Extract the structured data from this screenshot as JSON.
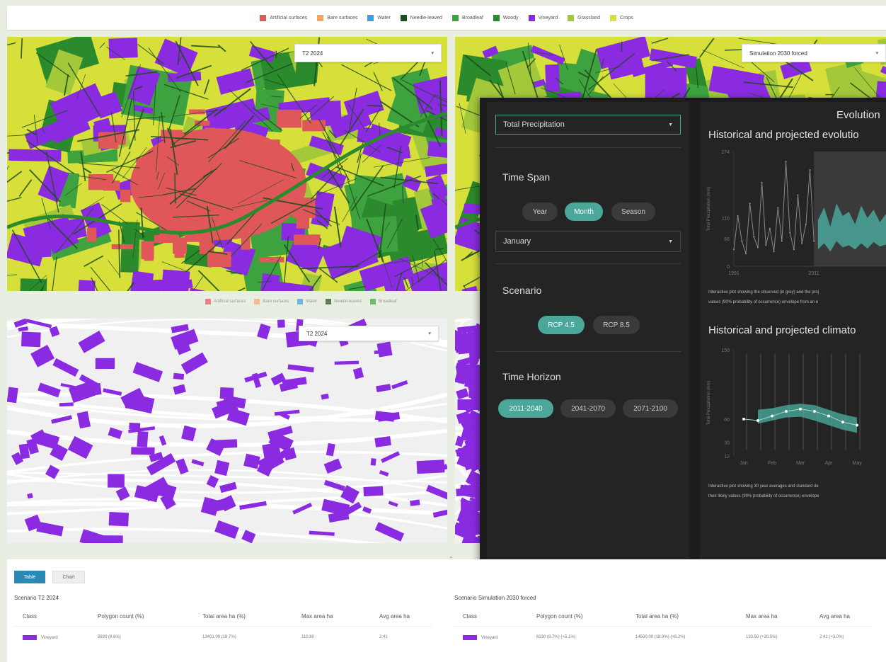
{
  "legend": {
    "items": [
      {
        "label": "Artificial surfaces",
        "color": "#e0575a"
      },
      {
        "label": "Bare surfaces",
        "color": "#f2a766"
      },
      {
        "label": "Water",
        "color": "#3aa0e0"
      },
      {
        "label": "Needle-leaved",
        "color": "#1d4d1d"
      },
      {
        "label": "Broadleaf",
        "color": "#3ea33e"
      },
      {
        "label": "Woody",
        "color": "#2b8a2b"
      },
      {
        "label": "Vineyard",
        "color": "#8a2be2"
      },
      {
        "label": "Grassland",
        "color": "#a3c83a"
      },
      {
        "label": "Crops",
        "color": "#d7e03a"
      }
    ]
  },
  "maps": {
    "top_left_select": "T2 2024",
    "top_right_select": "Simulation 2030 forced",
    "bottom_left_select": "T2 2024"
  },
  "panel": {
    "variable_select": "Total Precipitation",
    "time_span_title": "Time Span",
    "time_span_options": [
      "Year",
      "Month",
      "Season"
    ],
    "time_span_selected": "Month",
    "month_select": "January",
    "scenario_title": "Scenario",
    "scenario_options": [
      "RCP 4.5",
      "RCP 8.5"
    ],
    "scenario_selected": "RCP 4.5",
    "horizon_title": "Time Horizon",
    "horizon_options": [
      "2011-2040",
      "2041-2070",
      "2071-2100"
    ],
    "horizon_selected": "2011-2040",
    "main_title": "Evolution",
    "chart1_title": "Historical and projected evolutio",
    "chart1_desc_1": "Interactive plot showing the observed (in grey) and the proj",
    "chart1_desc_2": "values (90% probability of occurrence) envelope from an e",
    "chart2_title": "Historical and projected climato",
    "chart2_desc_1": "Interactive plot showing 30 year averages and standard de",
    "chart2_desc_2": "their likely values (90% probability of occurrence) envelope"
  },
  "chart_data": [
    {
      "type": "line",
      "title": "Historical and projected evolutio",
      "ylabel": "Total Precipitation (mm)",
      "y_ticks": [
        "274",
        "116",
        "66",
        "0"
      ],
      "x_ticks": [
        "1991",
        "2011"
      ],
      "ylim": [
        0,
        274
      ],
      "x": [
        1991,
        1992,
        1993,
        1994,
        1995,
        1996,
        1997,
        1998,
        1999,
        2000,
        2001,
        2002,
        2003,
        2004,
        2005,
        2006,
        2007,
        2008,
        2009,
        2010,
        2011,
        2012,
        2013,
        2014,
        2015,
        2016,
        2017,
        2018,
        2019,
        2020,
        2021,
        2022,
        2023
      ],
      "series": [
        {
          "values": [
            40,
            120,
            60,
            30,
            150,
            70,
            45,
            200,
            50,
            90,
            35,
            140,
            60,
            250,
            80,
            40,
            170,
            55,
            100,
            230,
            60,
            110,
            85,
            70,
            120,
            65,
            95,
            80,
            130,
            75,
            105,
            90,
            115
          ]
        }
      ],
      "band_low": [
        40,
        55,
        35,
        60,
        45,
        50,
        40,
        55,
        42,
        58,
        47,
        52
      ],
      "band_high": [
        110,
        140,
        95,
        150,
        120,
        130,
        100,
        145,
        115,
        135,
        105,
        125
      ]
    },
    {
      "type": "line",
      "title": "Historical and projected climato",
      "ylabel": "Total Precipitation (mm)",
      "y_ticks": [
        "150",
        "60",
        "30",
        "12"
      ],
      "categories": [
        "Jan",
        "Feb",
        "Mar",
        "Apr",
        "May"
      ],
      "ylim": [
        12,
        150
      ],
      "series": [
        {
          "values": [
            60,
            58,
            64,
            70,
            73,
            70,
            64,
            56,
            52
          ]
        }
      ],
      "band_low": [
        55,
        54,
        58,
        62,
        63,
        58,
        52,
        46,
        42
      ],
      "band_high": [
        72,
        72,
        74,
        78,
        80,
        78,
        72,
        66,
        62
      ]
    }
  ],
  "bottom": {
    "table_btn": "Table",
    "chart_btn": "Chart",
    "collapse_glyph": "⌃",
    "left": {
      "scenario": "Scenario T2 2024",
      "headers": [
        "Class",
        "Polygon count (%)",
        "Total area ha (%)",
        "Max area ha",
        "Avg area ha"
      ],
      "row": [
        "Vineyard",
        "5830 (8.8%)",
        "13401.00 (18.7%)",
        "110.80",
        "2.41"
      ]
    },
    "right": {
      "scenario": "Scenario Simulation 2030 forced",
      "headers": [
        "Class",
        "Polygon count (%)",
        "Total area ha (%)",
        "Max area ha",
        "Avg area ha"
      ],
      "row": [
        "Vineyard",
        "6130 (8.7%) (+5.1%)",
        "14500.00 (18.9%) (+8.2%)",
        "133.50 (+20.5%)",
        "2.41 (+3.0%)"
      ]
    }
  }
}
